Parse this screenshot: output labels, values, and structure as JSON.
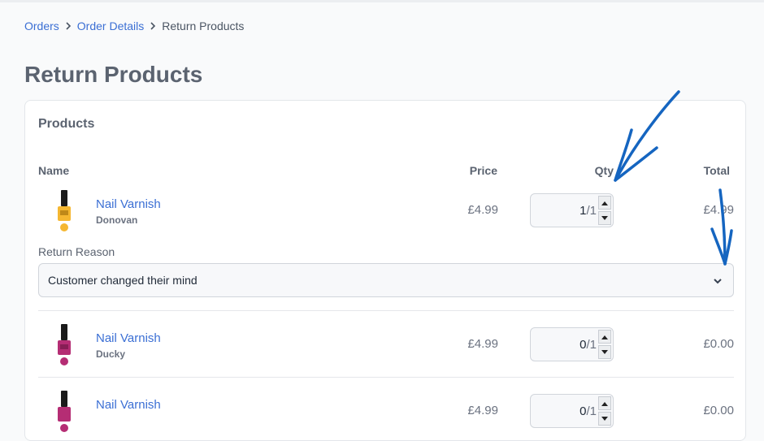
{
  "breadcrumb": {
    "items": [
      {
        "label": "Orders"
      },
      {
        "label": "Order Details"
      }
    ],
    "current": "Return Products"
  },
  "page": {
    "title": "Return Products"
  },
  "card": {
    "title": "Products"
  },
  "table": {
    "headers": {
      "name": "Name",
      "price": "Price",
      "qty": "Qty",
      "total": "Total"
    }
  },
  "products": [
    {
      "name": "Nail Varnish",
      "variant": "Donovan",
      "price": "£4.99",
      "qty": "1",
      "qty_max": "/1",
      "total": "£4.99",
      "color": "#f5b731"
    },
    {
      "name": "Nail Varnish",
      "variant": "Ducky",
      "price": "£4.99",
      "qty": "0",
      "qty_max": "/1",
      "total": "£0.00",
      "color": "#b52d74"
    },
    {
      "name": "Nail Varnish",
      "variant": "",
      "price": "£4.99",
      "qty": "0",
      "qty_max": "/1",
      "total": "£0.00",
      "color": "#b52d74"
    }
  ],
  "return_reason": {
    "label": "Return Reason",
    "selected": "Customer changed their mind"
  },
  "annotation_color": "#1565c0",
  "icons": [
    "chevron-right-icon",
    "chevron-down-icon",
    "spin-up-icon",
    "spin-down-icon",
    "annotation-arrow"
  ]
}
